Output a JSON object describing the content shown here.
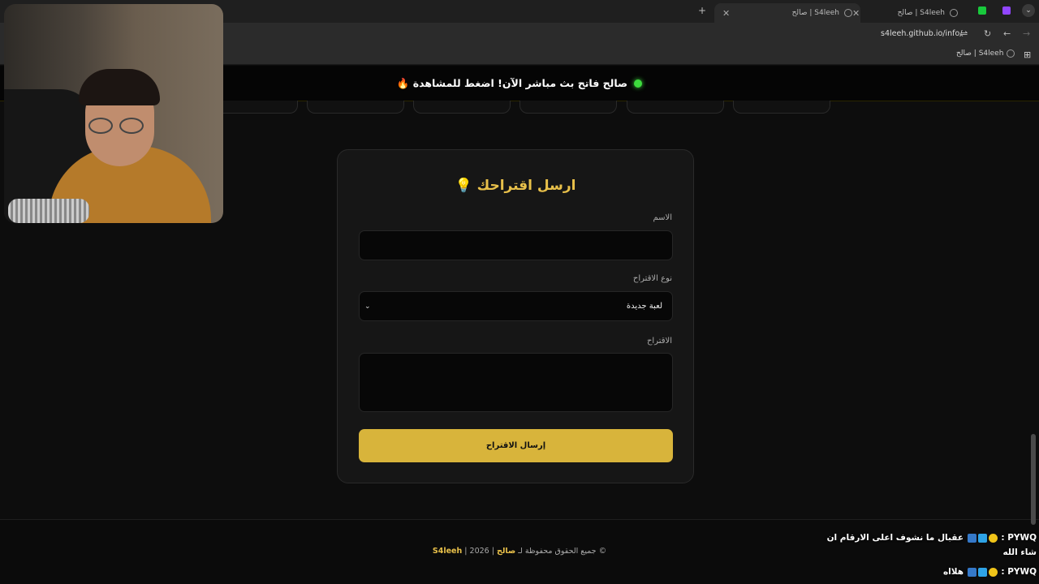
{
  "browser": {
    "tabs": [
      {
        "title": "S4leeh | صالح",
        "active": true
      },
      {
        "title": "S4leeh | صالح",
        "active": false
      }
    ],
    "url": "s4leeh.github.io/info/",
    "bookmark": "S4leeh | صالح"
  },
  "banner": {
    "text": "صالح فاتح بث مباشر الآن! اضغط للمشاهدة 🔥"
  },
  "form": {
    "title": "ارسل اقتراحك 💡",
    "name_label": "الاسم",
    "name_value": "",
    "type_label": "نوع الاقتراح",
    "type_value": "لعبة جديدة",
    "suggestion_label": "الاقتراح",
    "suggestion_value": "",
    "submit_label": "إرسال الاقتراح"
  },
  "footer": {
    "prefix": "© جميع الحقوق محفوظة لـ",
    "owner": "صالح",
    "year": "| 2026 |",
    "brand": "S4leeh"
  },
  "chat": [
    {
      "user": "PYWQ",
      "message": "عقبال ما نشوف اعلى الارقام ان شاء الله"
    },
    {
      "user": "PYWQ",
      "message": "هلااه"
    }
  ],
  "colors": {
    "accent": "#d8b43b",
    "title_gold": "#e8c04a",
    "live": "#3ddc3d",
    "background": "#0d0d0d"
  }
}
